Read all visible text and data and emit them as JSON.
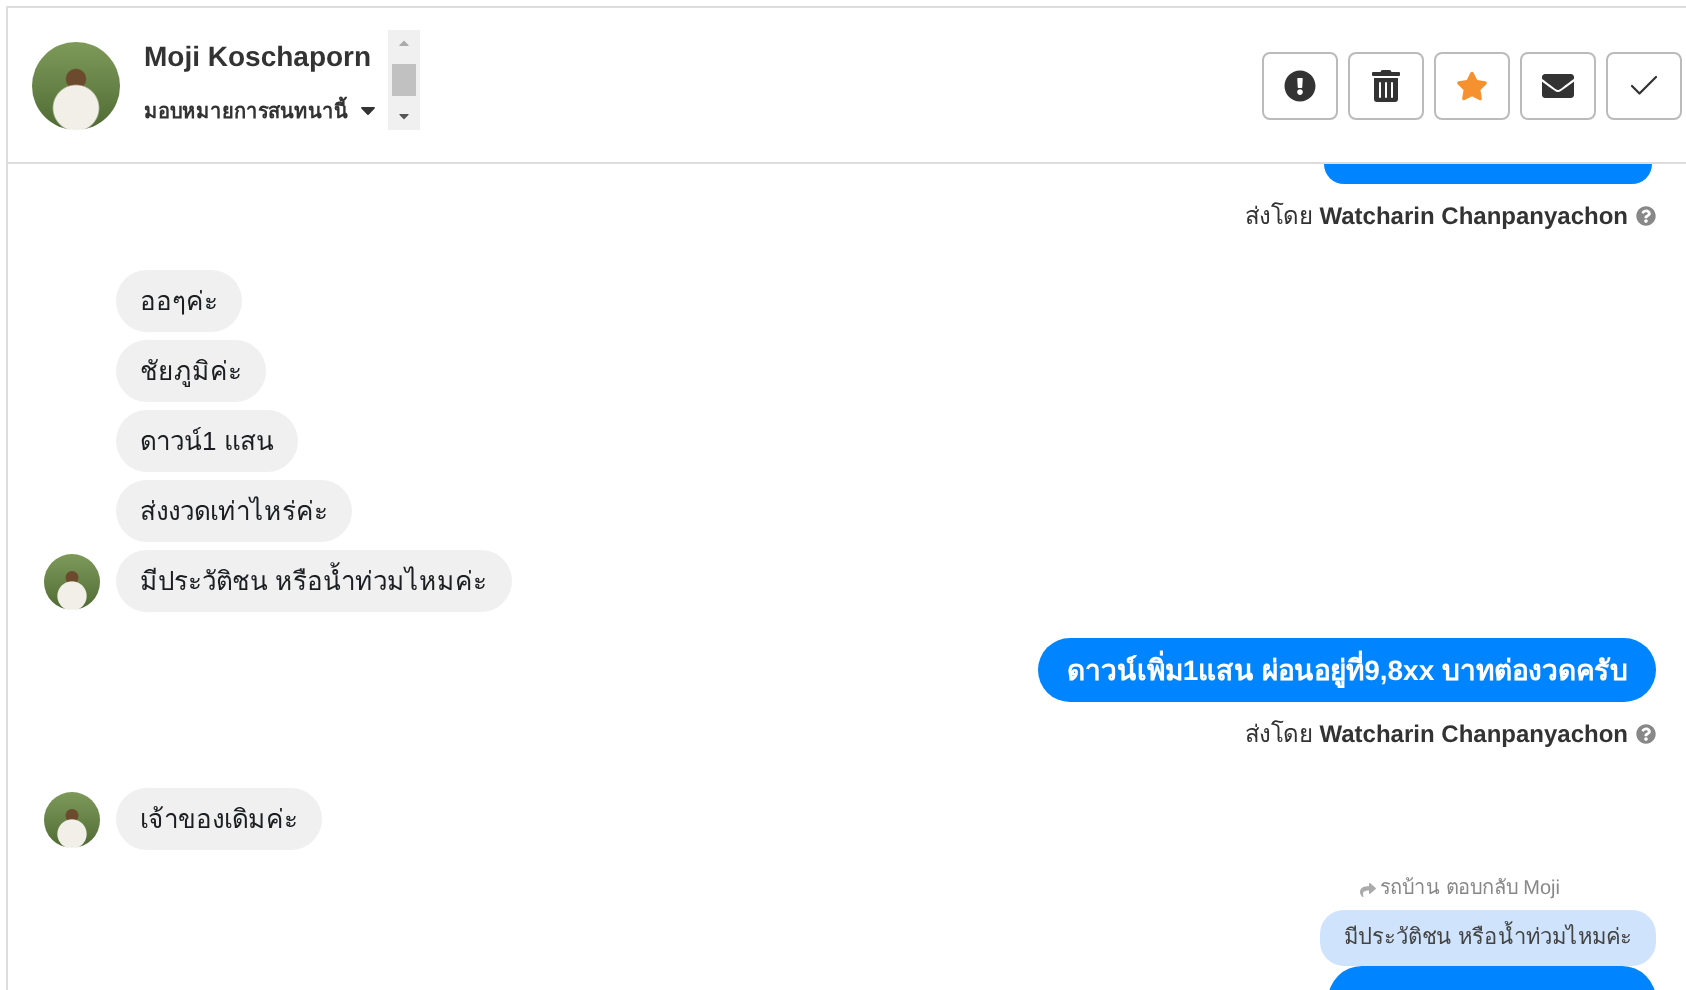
{
  "header": {
    "contact_name": "Moji Koschaporn",
    "assign_label": "มอบหมายการสนทนานี้",
    "actions": [
      {
        "kind": "alert",
        "active": false
      },
      {
        "kind": "delete",
        "active": false
      },
      {
        "kind": "star",
        "active": true
      },
      {
        "kind": "mail",
        "active": false
      },
      {
        "kind": "done",
        "active": false
      }
    ]
  },
  "messages": [
    {
      "kind": "outgoing_cut"
    },
    {
      "kind": "sent_by",
      "text": "ส่งโดย **Watcharin Chanpanyachon**"
    },
    {
      "kind": "incoming",
      "text": "ออๆค่ะ",
      "avatar": false
    },
    {
      "kind": "incoming",
      "text": "ชัยภูมิค่ะ",
      "avatar": false
    },
    {
      "kind": "incoming",
      "text": "ดาวน์1 แสน",
      "avatar": false
    },
    {
      "kind": "incoming",
      "text": "ส่งงวดเท่าไหร่ค่ะ",
      "avatar": false
    },
    {
      "kind": "incoming",
      "text": "มีประวัติชน หรือน้ำท่วมไหมค่ะ",
      "avatar": true
    },
    {
      "kind": "outgoing",
      "text": "ดาวน์เพิ่ม1แสน ผ่อนอยู่ที่9,8xx บาทต่องวดครับ"
    },
    {
      "kind": "sent_by",
      "text": "ส่งโดย **Watcharin Chanpanyachon**"
    },
    {
      "kind": "incoming",
      "text": "เจ้าของเดิมค่ะ",
      "avatar": true
    },
    {
      "kind": "reply_quote",
      "text": "รถบ้าน ตอบกลับ Moji"
    },
    {
      "kind": "quoted",
      "text": "มีประวัติชน หรือน้ำท่วมไหมค่ะ"
    },
    {
      "kind": "outgoing_cut"
    }
  ]
}
